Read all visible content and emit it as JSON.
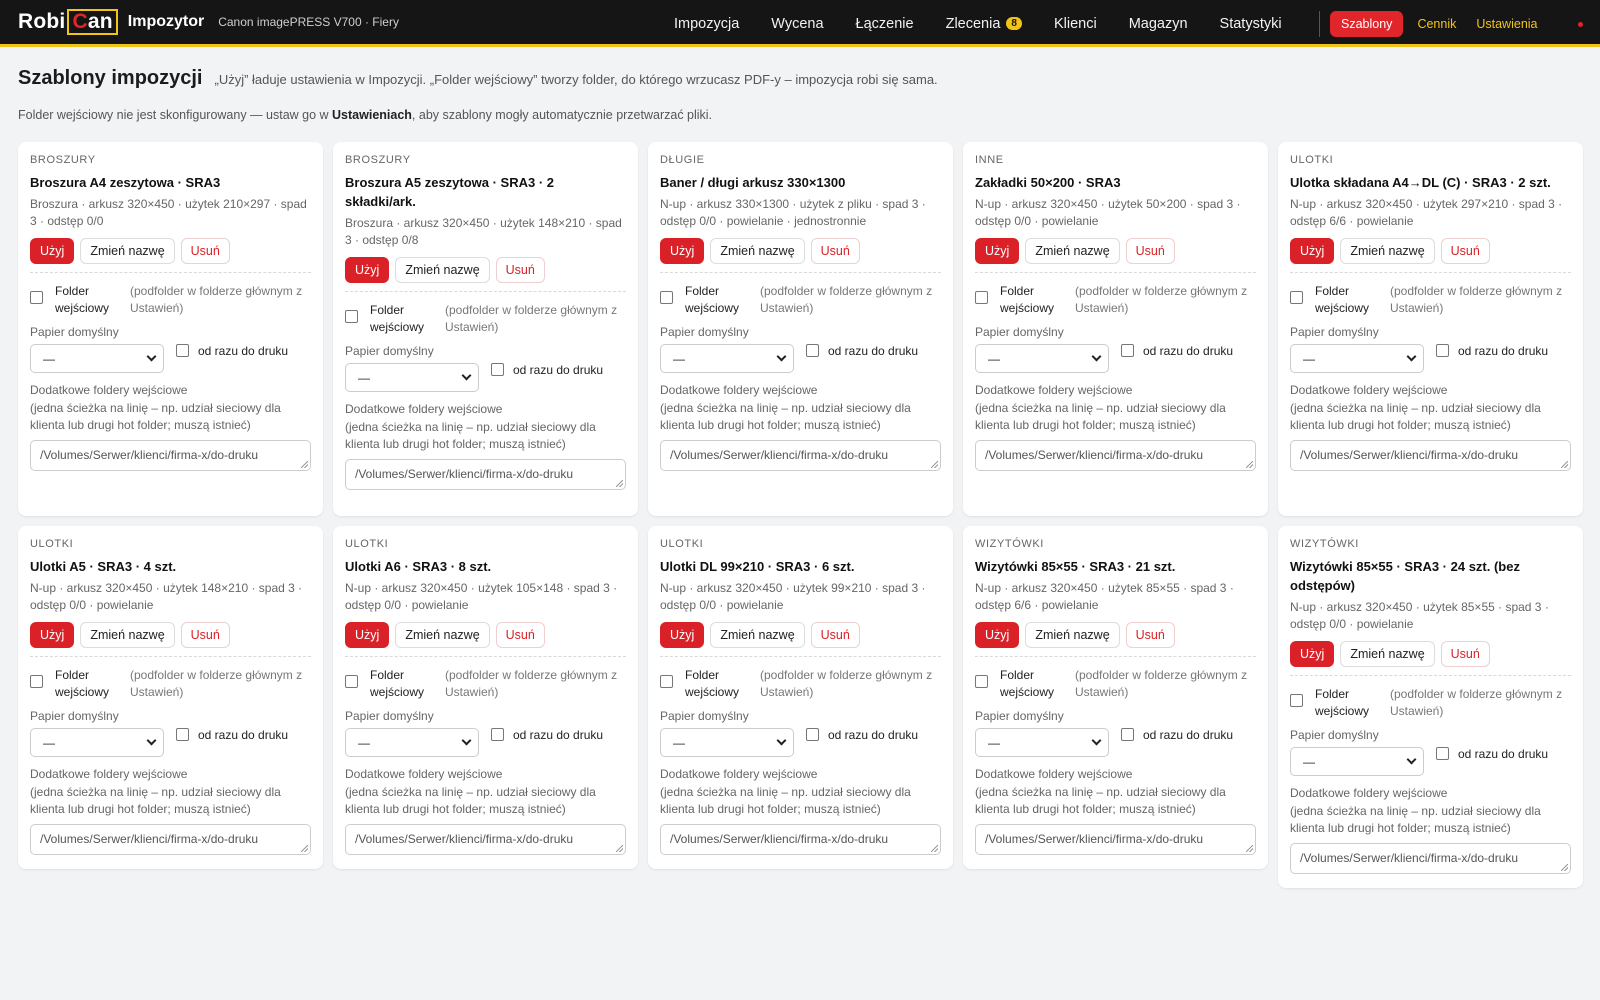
{
  "header": {
    "logo_robi": "Robi",
    "logo_c": "C",
    "logo_an": "an",
    "app_name": "Impozytor",
    "printer": "Canon imagePRESS V700 · Fiery",
    "nav": [
      {
        "label": "Impozycja",
        "badge": ""
      },
      {
        "label": "Wycena",
        "badge": ""
      },
      {
        "label": "Łączenie",
        "badge": ""
      },
      {
        "label": "Zlecenia",
        "badge": "8"
      },
      {
        "label": "Klienci",
        "badge": ""
      },
      {
        "label": "Magazyn",
        "badge": ""
      },
      {
        "label": "Statystyki",
        "badge": ""
      }
    ],
    "active_button": "Szablony",
    "links": [
      "Cennik",
      "Ustawienia"
    ]
  },
  "page": {
    "title": "Szablony impozycji",
    "description": "„Użyj” ładuje ustawienia w Impozycji. „Folder wejściowy” tworzy folder, do którego wrzucasz PDF-y – impozycja robi się sama.",
    "notice_pre": "Folder wejściowy nie jest skonfigurowany — ustaw go w ",
    "notice_bold": "Ustawieniach",
    "notice_post": ", aby szablony mogły automatycznie przetwarzać pliki."
  },
  "labels": {
    "use": "Użyj",
    "rename": "Zmień nazwę",
    "delete": "Usuń",
    "folder": "Folder wejściowy",
    "folder_hint": "(podfolder w folderze głównym z Ustawień)",
    "paper": "Papier domyślny",
    "paper_value": "—",
    "direct_print": "od razu do druku",
    "extra_folders": "Dodatkowe foldery wejściowe",
    "extra_hint": "(jedna ścieżka na linię – np. udział sieciowy dla klienta lub drugi hot folder; muszą istnieć)",
    "extra_placeholder": "/Volumes/Serwer/klienci/firma-x/do-druku"
  },
  "templates": [
    {
      "category": "BROSZURY",
      "title": "Broszura A4 zeszytowa · SRA3",
      "meta": "Broszura · arkusz 320×450 · użytek 210×297 · spad 3 · odstęp 0/0"
    },
    {
      "category": "BROSZURY",
      "title": "Broszura A5 zeszytowa · SRA3 · 2 składki/ark.",
      "meta": "Broszura · arkusz 320×450 · użytek 148×210 · spad 3 · odstęp 0/8"
    },
    {
      "category": "DŁUGIE",
      "title": "Baner / długi arkusz 330×1300",
      "meta": "N-up · arkusz 330×1300 · użytek z pliku · spad 3 · odstęp 0/0 · powielanie · jednostronnie"
    },
    {
      "category": "INNE",
      "title": "Zakładki 50×200 · SRA3",
      "meta": "N-up · arkusz 320×450 · użytek 50×200 · spad 3 · odstęp 0/0 · powielanie"
    },
    {
      "category": "ULOTKI",
      "title": "Ulotka składana A4→DL (C) · SRA3 · 2 szt.",
      "meta": "N-up · arkusz 320×450 · użytek 297×210 · spad 3 · odstęp 6/6 · powielanie"
    },
    {
      "category": "ULOTKI",
      "title": "Ulotki A5 · SRA3 · 4 szt.",
      "meta": "N-up · arkusz 320×450 · użytek 148×210 · spad 3 · odstęp 0/0 · powielanie"
    },
    {
      "category": "ULOTKI",
      "title": "Ulotki A6 · SRA3 · 8 szt.",
      "meta": "N-up · arkusz 320×450 · użytek 105×148 · spad 3 · odstęp 0/0 · powielanie"
    },
    {
      "category": "ULOTKI",
      "title": "Ulotki DL 99×210 · SRA3 · 6 szt.",
      "meta": "N-up · arkusz 320×450 · użytek 99×210 · spad 3 · odstęp 0/0 · powielanie"
    },
    {
      "category": "WIZYTÓWKI",
      "title": "Wizytówki 85×55 · SRA3 · 21 szt.",
      "meta": "N-up · arkusz 320×450 · użytek 85×55 · spad 3 · odstęp 6/6 · powielanie"
    },
    {
      "category": "WIZYTÓWKI",
      "title": "Wizytówki 85×55 · SRA3 · 24 szt. (bez odstępów)",
      "meta": "N-up · arkusz 320×450 · użytek 85×55 · spad 3 · odstęp 0/0 · powielanie"
    }
  ]
}
